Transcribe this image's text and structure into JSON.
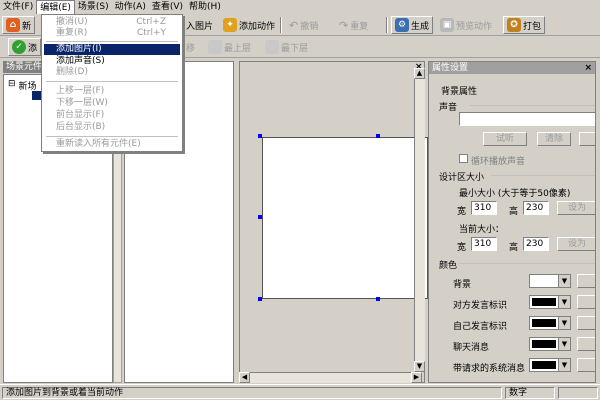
{
  "menubar": {
    "items": [
      "文件(F)",
      "编辑(E)",
      "场景(S)",
      "动作(A)",
      "查看(V)",
      "帮助(H)"
    ]
  },
  "toolbar1": {
    "new_label": "新",
    "import_image_label": "入图片",
    "add_action_label": "添加动作",
    "undo_label": "撤销",
    "redo_label": "重复",
    "generate_label": "生成",
    "preview_label": "预览动作",
    "package_label": "打包"
  },
  "toolbar2": {
    "add_label": "添",
    "move_label": "移",
    "top_label": "最上层",
    "bottom_label": "最下层"
  },
  "dropdown": {
    "items": [
      {
        "label": "撤消(U)",
        "shortcut": "Ctrl+Z",
        "disabled": true
      },
      {
        "label": "重复(R)",
        "shortcut": "Ctrl+Y",
        "disabled": true
      },
      {
        "label": "添加图片(I)",
        "shortcut": "",
        "disabled": false,
        "highlighted": true
      },
      {
        "label": "添加声音(S)",
        "shortcut": "",
        "disabled": false
      },
      {
        "label": "删除(D)",
        "shortcut": "",
        "disabled": true
      },
      {
        "label": "上移一层(F)",
        "shortcut": "",
        "disabled": true
      },
      {
        "label": "下移一层(W)",
        "shortcut": "",
        "disabled": true
      },
      {
        "label": "前台显示(F)",
        "shortcut": "",
        "disabled": true
      },
      {
        "label": "后台显示(B)",
        "shortcut": "",
        "disabled": true
      },
      {
        "label": "重新读入所有元件(E)",
        "shortcut": "",
        "disabled": true
      }
    ]
  },
  "leftpanel": {
    "title": "场景元件",
    "tree_root": "新场",
    "tree_expander": "⊟"
  },
  "props": {
    "title": "属性设置",
    "bg_section": "背景属性",
    "sound_section": "声音",
    "listen_btn": "试听",
    "clear_btn": "清除",
    "loop_label": "循环播放声音",
    "design_size_section": "设计区大小",
    "min_size_label": "最小大小 (大于等于50像素)",
    "width_label": "宽",
    "height_label": "高",
    "min_width": "310",
    "min_height": "230",
    "set_btn": "设为",
    "current_size_label": "当前大小：",
    "cur_width": "310",
    "cur_height": "230",
    "color_section": "颜色",
    "color_items": [
      {
        "label": "背景",
        "color": "#ffffff"
      },
      {
        "label": "对方发言标识",
        "color": "#000000"
      },
      {
        "label": "自己发言标识",
        "color": "#000000"
      },
      {
        "label": "聊天消息",
        "color": "#000000"
      },
      {
        "label": "带请求的系统消息",
        "color": "#000000"
      }
    ]
  },
  "statusbar": {
    "message": "添加图片到背景或着当前动作",
    "mode": "数字"
  }
}
